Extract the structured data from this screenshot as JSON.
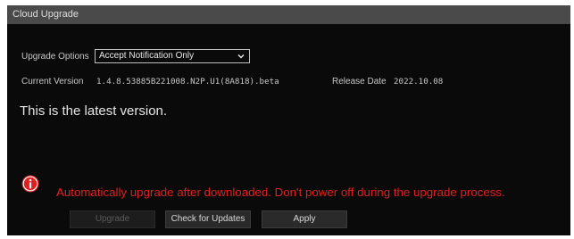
{
  "window": {
    "title": "Cloud Upgrade"
  },
  "upgrade_options": {
    "label": "Upgrade Options",
    "selected": "Accept Notification Only"
  },
  "current_version": {
    "label": "Current Version",
    "value": "1.4.8.53885B221008.N2P.U1(8A818).beta"
  },
  "release_date": {
    "label": "Release Date",
    "value": "2022.10.08"
  },
  "status_message": "This is the latest version.",
  "warning": {
    "text": "Automatically upgrade after downloaded. Don't power off during the upgrade process.",
    "color": "#e02020"
  },
  "buttons": {
    "upgrade": "Upgrade",
    "check": "Check for Updates",
    "apply": "Apply"
  },
  "icons": {
    "dropdown": "chevron-down-icon",
    "warning": "info-circle-icon"
  }
}
